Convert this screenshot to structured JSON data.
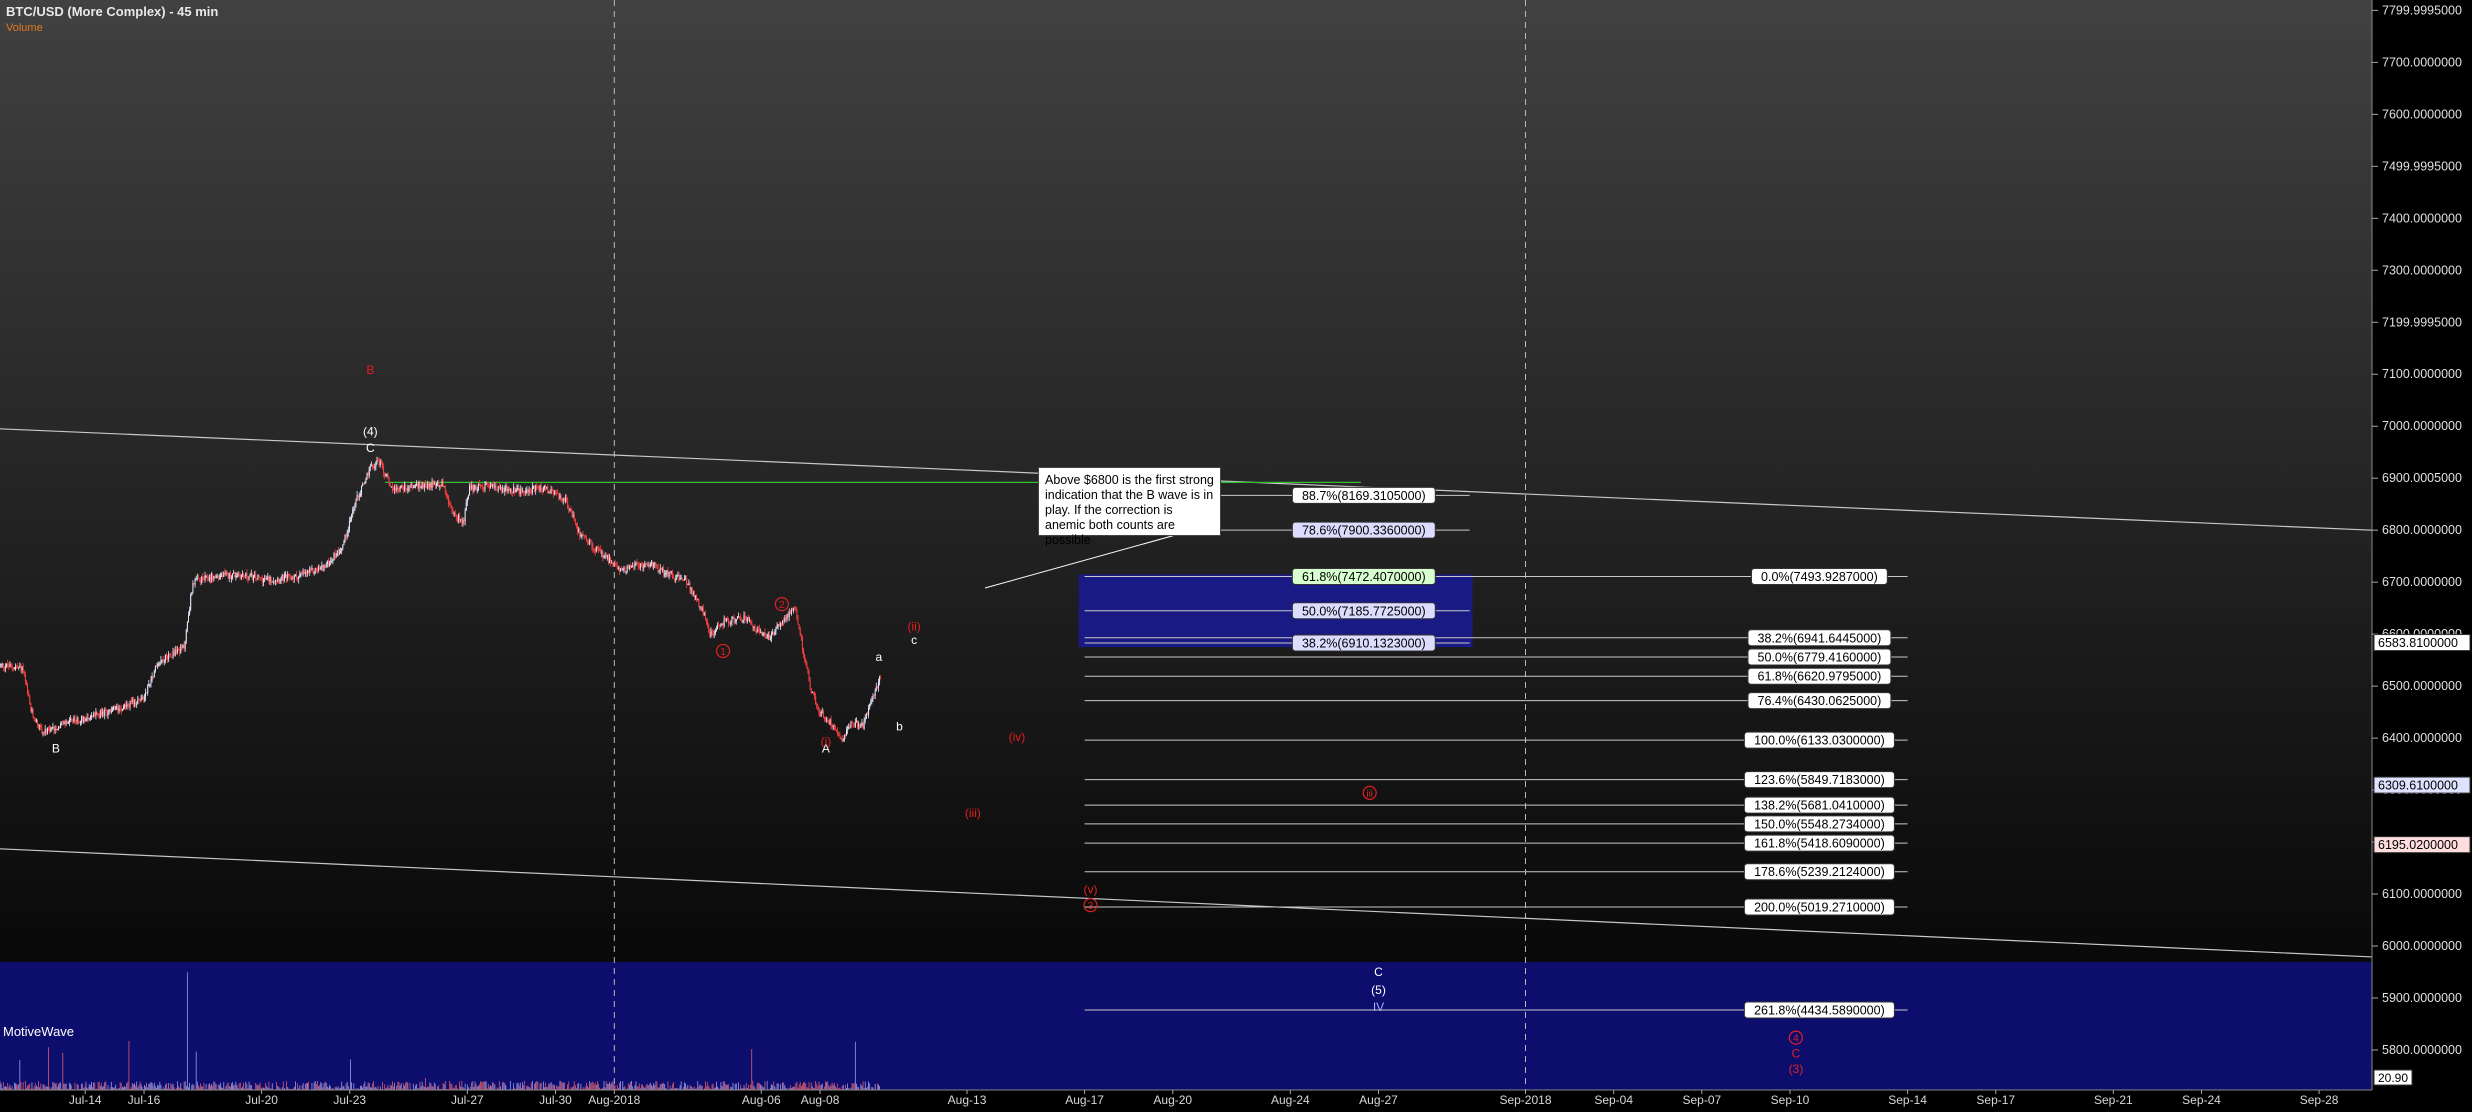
{
  "header": {
    "title": "BTC/USD (More Complex) - 45 min",
    "volume_label": "Volume"
  },
  "annotation_note": "Above $6800 is the first strong indication that the B wave is in play. If the correction is anemic both counts are possible",
  "watermark": "MotiveWave",
  "colors": {
    "background_top": "#414141",
    "background_bottom": "#000000",
    "up_candle": "#e8e8ff",
    "down_candle": "#ff4040",
    "wave_red": "#e02020",
    "wave_white": "#ffffff",
    "fib_line": "#c8c8c8",
    "fib_box": "#1a1a8a",
    "volume_panel": "#0d0d6e",
    "green_line": "#30c030"
  },
  "chart_data": {
    "type": "candlestick",
    "title": "BTC/USD (More Complex) - 45 min",
    "ylim": [
      5723.0,
      7820.0
    ],
    "y_ticks": [
      "7799.9995000",
      "7700.0000000",
      "7600.0000000",
      "7499.9995000",
      "7400.0000000",
      "7300.0000000",
      "7199.9995000",
      "7100.0000000",
      "7000.0000000",
      "6900.0005000",
      "6800.0000000",
      "6700.0000000",
      "6600.0000000",
      "6500.0000000",
      "6400.0000000",
      "6300.0000000",
      "6200.0000000",
      "6100.0000000",
      "6000.0000000",
      "5900.0000000",
      "5800.0000000"
    ],
    "y_tick_values": [
      7800,
      7700,
      7600,
      7500,
      7400,
      7300,
      7200,
      7100,
      7000,
      6900,
      6800,
      6700,
      6600,
      6500,
      6400,
      6300,
      6200,
      6100,
      6000,
      5900,
      5800
    ],
    "x_ticks": [
      {
        "label": "Jul-14",
        "day": 13.8
      },
      {
        "label": "Jul-16",
        "day": 15.8
      },
      {
        "label": "Jul-20",
        "day": 19.8
      },
      {
        "label": "Jul-23",
        "day": 22.8
      },
      {
        "label": "Jul-27",
        "day": 26.8
      },
      {
        "label": "Jul-30",
        "day": 29.8
      },
      {
        "label": "Aug-2018",
        "day": 31.8
      },
      {
        "label": "Aug-06",
        "day": 36.8
      },
      {
        "label": "Aug-08",
        "day": 38.8
      },
      {
        "label": "Aug-13",
        "day": 43.8
      },
      {
        "label": "Aug-17",
        "day": 47.8
      },
      {
        "label": "Aug-20",
        "day": 50.8
      },
      {
        "label": "Aug-24",
        "day": 54.8
      },
      {
        "label": "Aug-27",
        "day": 57.8
      },
      {
        "label": "Sep-2018",
        "day": 62.8
      },
      {
        "label": "Sep-04",
        "day": 65.8
      },
      {
        "label": "Sep-07",
        "day": 68.8
      },
      {
        "label": "Sep-10",
        "day": 71.8
      },
      {
        "label": "Sep-14",
        "day": 75.8
      },
      {
        "label": "Sep-17",
        "day": 78.8
      },
      {
        "label": "Sep-21",
        "day": 82.8
      },
      {
        "label": "Sep-24",
        "day": 85.8
      },
      {
        "label": "Sep-28",
        "day": 89.8
      }
    ],
    "x_range_days": [
      10.9,
      91.6
    ],
    "price_path": [
      [
        10.9,
        6540
      ],
      [
        11.7,
        6535
      ],
      [
        12.0,
        6450
      ],
      [
        12.4,
        6410
      ],
      [
        13.2,
        6430
      ],
      [
        14.6,
        6450
      ],
      [
        15.8,
        6475
      ],
      [
        16.3,
        6545
      ],
      [
        16.7,
        6560
      ],
      [
        17.2,
        6575
      ],
      [
        17.5,
        6700
      ],
      [
        18.2,
        6710
      ],
      [
        19.0,
        6715
      ],
      [
        20.0,
        6705
      ],
      [
        21.0,
        6710
      ],
      [
        22.0,
        6730
      ],
      [
        22.6,
        6770
      ],
      [
        23.0,
        6850
      ],
      [
        23.5,
        6915
      ],
      [
        23.8,
        6935
      ],
      [
        24.3,
        6880
      ],
      [
        25.0,
        6885
      ],
      [
        26.0,
        6890
      ],
      [
        26.3,
        6835
      ],
      [
        26.7,
        6815
      ],
      [
        26.9,
        6880
      ],
      [
        27.5,
        6885
      ],
      [
        28.5,
        6875
      ],
      [
        29.5,
        6880
      ],
      [
        30.2,
        6855
      ],
      [
        30.7,
        6790
      ],
      [
        31.3,
        6760
      ],
      [
        32.0,
        6725
      ],
      [
        33.0,
        6735
      ],
      [
        33.8,
        6715
      ],
      [
        34.3,
        6700
      ],
      [
        34.8,
        6650
      ],
      [
        35.1,
        6600
      ],
      [
        35.6,
        6625
      ],
      [
        36.3,
        6630
      ],
      [
        36.8,
        6600
      ],
      [
        37.2,
        6595
      ],
      [
        37.6,
        6630
      ],
      [
        38.0,
        6645
      ],
      [
        38.5,
        6500
      ],
      [
        38.8,
        6450
      ],
      [
        39.2,
        6430
      ],
      [
        39.6,
        6400
      ],
      [
        39.9,
        6430
      ],
      [
        40.3,
        6425
      ],
      [
        40.6,
        6475
      ],
      [
        40.9,
        6515
      ]
    ],
    "candle_count": 800,
    "series": [
      {
        "name": "Volume",
        "panel": "volume"
      }
    ],
    "volume_ylim": [
      0,
      250
    ],
    "volume_label_value": "20.90",
    "price_labels": [
      {
        "text": "6583.8100000",
        "value": 6583.81,
        "style": "white"
      },
      {
        "text": "6309.6100000",
        "value": 6309.61,
        "style": "blue"
      },
      {
        "text": "6195.0200000",
        "value": 6195.02,
        "style": "pink"
      }
    ],
    "trendlines": [
      {
        "from": [
          10.9,
          6995
        ],
        "to": [
          91.6,
          6800
        ],
        "color": "#c8c8c8"
      },
      {
        "from": [
          10.9,
          6187
        ],
        "to": [
          91.6,
          5979
        ],
        "color": "#c8c8c8"
      },
      {
        "from": [
          24.0,
          6892
        ],
        "to": [
          57.2,
          6892
        ],
        "color": "#30c030"
      }
    ],
    "vertical_lines": [
      31.8,
      62.8
    ],
    "fib_box": {
      "x0": 47.6,
      "x1": 61.0,
      "y0": 6575,
      "y1": 6715,
      "color": "#1a1a8a"
    },
    "fib_retracement_upper": [
      {
        "text": "88.7%(8169.3105000)",
        "value": 6867,
        "x0": 47.8,
        "x1": 60.9,
        "label_day": 57.3,
        "style": "white"
      },
      {
        "text": "78.6%(7900.3360000)",
        "value": 6800,
        "x0": 47.8,
        "x1": 60.9,
        "label_day": 57.3,
        "style": "blue"
      },
      {
        "text": "61.8%(7472.4070000)",
        "value": 6711,
        "x0": 47.8,
        "x1": 60.9,
        "label_day": 57.3,
        "style": "green"
      },
      {
        "text": "50.0%(7185.7725000)",
        "value": 6645,
        "x0": 47.8,
        "x1": 60.9,
        "label_day": 57.3,
        "style": "blue"
      },
      {
        "text": "38.2%(6910.1323000)",
        "value": 6583,
        "x0": 47.8,
        "x1": 60.9,
        "label_day": 57.3,
        "style": "blue"
      }
    ],
    "fib_projection": [
      {
        "text": "0.0%(7493.9287000)",
        "value": 6711,
        "x0": 47.8,
        "x1": 75.8,
        "label_day": 72.8
      },
      {
        "text": "38.2%(6941.6445000)",
        "value": 6593,
        "x0": 47.8,
        "x1": 75.8,
        "label_day": 72.8
      },
      {
        "text": "50.0%(6779.4160000)",
        "value": 6556,
        "x0": 47.8,
        "x1": 75.8,
        "label_day": 72.8
      },
      {
        "text": "61.8%(6620.9795000)",
        "value": 6519,
        "x0": 47.8,
        "x1": 75.8,
        "label_day": 72.8
      },
      {
        "text": "76.4%(6430.0625000)",
        "value": 6472,
        "x0": 47.8,
        "x1": 75.8,
        "label_day": 72.8
      },
      {
        "text": "100.0%(6133.0300000)",
        "value": 6396,
        "x0": 47.8,
        "x1": 75.8,
        "label_day": 72.8
      },
      {
        "text": "123.6%(5849.7183000)",
        "value": 6320,
        "x0": 47.8,
        "x1": 75.8,
        "label_day": 72.8
      },
      {
        "text": "138.2%(5681.0410000)",
        "value": 6271,
        "x0": 47.8,
        "x1": 75.8,
        "label_day": 72.8
      },
      {
        "text": "150.0%(5548.2734000)",
        "value": 6235,
        "x0": 47.8,
        "x1": 75.8,
        "label_day": 72.8
      },
      {
        "text": "161.8%(5418.6090000)",
        "value": 6198,
        "x0": 47.8,
        "x1": 75.8,
        "label_day": 72.8
      },
      {
        "text": "178.6%(5239.2124000)",
        "value": 6143,
        "x0": 47.8,
        "x1": 75.8,
        "label_day": 72.8
      },
      {
        "text": "200.0%(5019.2710000)",
        "value": 6075,
        "x0": 47.8,
        "x1": 75.8,
        "label_day": 72.8
      },
      {
        "text": "261.8%(4434.5890000)",
        "value": 5877,
        "x0": 47.8,
        "x1": 75.8,
        "label_day": 72.8
      }
    ],
    "wave_labels": [
      {
        "text": "B",
        "day": 12.8,
        "value": 6372,
        "color": "white"
      },
      {
        "text": "(4)",
        "day": 23.5,
        "value": 6982,
        "color": "white"
      },
      {
        "text": "C",
        "day": 23.5,
        "value": 6950,
        "color": "white"
      },
      {
        "text": "B",
        "day": 23.5,
        "value": 7100,
        "color": "red"
      },
      {
        "text": "1",
        "day": 35.5,
        "value": 6560,
        "color": "red",
        "circled": true
      },
      {
        "text": "2",
        "day": 37.5,
        "value": 6650,
        "color": "red",
        "circled": true
      },
      {
        "text": "a",
        "day": 40.8,
        "value": 6548,
        "color": "white"
      },
      {
        "text": "b",
        "day": 41.5,
        "value": 6415,
        "color": "white"
      },
      {
        "text": "c",
        "day": 42.0,
        "value": 6581,
        "color": "white"
      },
      {
        "text": "A",
        "day": 39.0,
        "value": 6372,
        "color": "white"
      },
      {
        "text": "(i)",
        "day": 39.0,
        "value": 6386,
        "color": "red"
      },
      {
        "text": "(ii)",
        "day": 42.0,
        "value": 6607,
        "color": "red"
      },
      {
        "text": "(iv)",
        "day": 45.5,
        "value": 6394,
        "color": "red"
      },
      {
        "text": "(iii)",
        "day": 44.0,
        "value": 6248,
        "color": "red"
      },
      {
        "text": "(v)",
        "day": 48.0,
        "value": 6101,
        "color": "red"
      },
      {
        "text": "3",
        "day": 48.0,
        "value": 6071,
        "color": "red",
        "circled": true
      },
      {
        "text": "iii",
        "day": 57.5,
        "value": 6287,
        "color": "red",
        "circled": true
      },
      {
        "text": "C",
        "day": 57.8,
        "value": 5942,
        "color": "white"
      },
      {
        "text": "(5)",
        "day": 57.8,
        "value": 5908,
        "color": "white"
      },
      {
        "text": "IV",
        "day": 57.8,
        "value": 5875,
        "color": "#9fb4ff"
      },
      {
        "text": "4",
        "day": 72.0,
        "value": 5816,
        "color": "red",
        "circled": true
      },
      {
        "text": "C",
        "day": 72.0,
        "value": 5786,
        "color": "red"
      },
      {
        "text": "(3)",
        "day": 72.0,
        "value": 5756,
        "color": "red"
      }
    ],
    "grid": false,
    "volume_panel_color": "#0d0d6e"
  }
}
